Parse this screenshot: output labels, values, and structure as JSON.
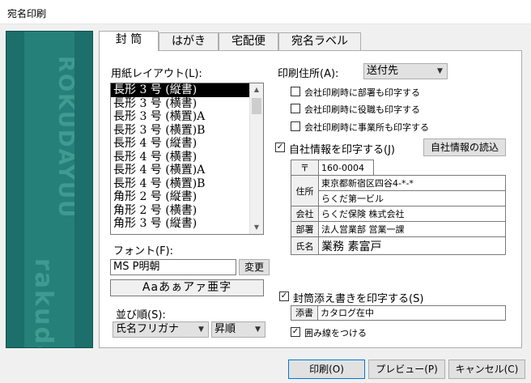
{
  "window": {
    "title": "宛名印刷"
  },
  "side_image": {
    "text_top": "ROKUDAYUU",
    "text_bottom": "rakuda",
    "color": "#1c6f6a"
  },
  "tabs": [
    "封 筒",
    "はがき",
    "宅配便",
    "宛名ラベル"
  ],
  "layout": {
    "label": "用紙レイアウト(L):",
    "items": [
      "長形 3 号 (縦書)",
      "長形 3 号 (横書)",
      "長形 3 号 (横置)A",
      "長形 3 号 (横置)B",
      "長形 4 号 (縦書)",
      "長形 4 号 (横書)",
      "長形 4 号 (横置)A",
      "長形 4 号 (横置)B",
      "角形 2 号 (縦書)",
      "角形 2 号 (横書)",
      "角形 3 号 (縦書)"
    ],
    "selected_index": 0
  },
  "font": {
    "label": "フォント(F):",
    "value": "MS P明朝",
    "change_button": "変更",
    "sample": "Aaあぁアァ亜字"
  },
  "sort": {
    "label": "並び順(S):",
    "field": "氏名フリガナ",
    "order": "昇順"
  },
  "print_address": {
    "label": "印刷住所(A):",
    "value": "送付先"
  },
  "options": [
    {
      "label": "会社印刷時に部署も印字する",
      "checked": false
    },
    {
      "label": "会社印刷時に役職も印字する",
      "checked": false
    },
    {
      "label": "会社印刷時に事業所も印字する",
      "checked": false
    }
  ],
  "own_company": {
    "label": "自社情報を印字する(J)",
    "checked": true,
    "load_button": "自社情報の読込"
  },
  "company_info": {
    "postal_label": "〒",
    "postal": "160-0004",
    "address_label": "住所",
    "address1": "東京都新宿区四谷4-*-*",
    "address2": "らくだ第一ビル",
    "company_label": "会社",
    "company": "らくだ保険 株式会社",
    "dept_label": "部署",
    "dept": "法人営業部 営業一課",
    "name_label": "氏名",
    "name": "業務 素富戸"
  },
  "envelope_note": {
    "label": "封筒添え書きを印字する(S)",
    "checked": true,
    "note_label": "添書",
    "note_value": "カタログ在中",
    "frame_label": "囲み線をつける",
    "frame_checked": true
  },
  "buttons": {
    "print": "印刷(O)",
    "preview": "プレビュー(P)",
    "cancel": "キャンセル(C)"
  }
}
